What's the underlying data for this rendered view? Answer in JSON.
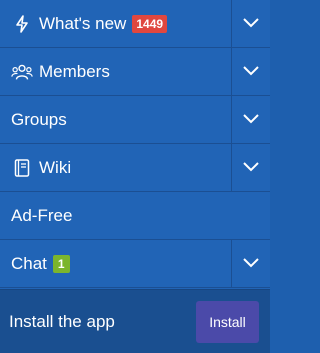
{
  "menu": {
    "whats_new": {
      "label": "What's new",
      "badge": "1449",
      "icon": "lightning-icon"
    },
    "members": {
      "label": "Members",
      "icon": "users-icon"
    },
    "groups": {
      "label": "Groups"
    },
    "wiki": {
      "label": "Wiki",
      "icon": "book-icon"
    },
    "ad_free": {
      "label": "Ad-Free"
    },
    "chat": {
      "label": "Chat",
      "badge": "1"
    }
  },
  "install": {
    "text": "Install the app",
    "button_label": "Install"
  },
  "colors": {
    "background": "#2164b6",
    "divider": "#1b4f93",
    "badge_red": "#e0473f",
    "badge_green": "#7bb52d",
    "install_bar": "#1a4f90",
    "install_button": "#4b4aa9"
  }
}
